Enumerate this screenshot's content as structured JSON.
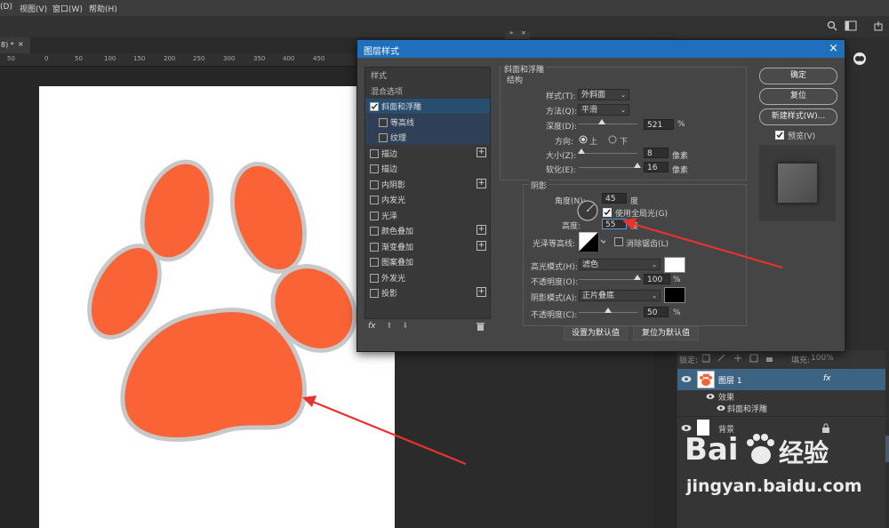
{
  "menu": {
    "items": [
      "(D)",
      "视图(V)",
      "窗口(W)",
      "帮助(H)"
    ]
  },
  "document": {
    "tab_label": "8) *",
    "close": "×"
  },
  "ruler": {
    "ticks": [
      "50",
      "0",
      "50",
      "100",
      "150",
      "200",
      "250",
      "300",
      "350",
      "400",
      "450"
    ]
  },
  "colors": {
    "paw": "#f96336",
    "paw_outline": "#c8c8c8",
    "annotation": "#e8322e",
    "accent": "#1f6fbd",
    "canvas": "#ffffff"
  },
  "dialog": {
    "title": "图层样式",
    "close": "×",
    "styles_list": [
      {
        "label": "样式",
        "checkbox": false,
        "checked": false,
        "plus": false,
        "state": "header"
      },
      {
        "label": "混合选项",
        "checkbox": false,
        "checked": false,
        "plus": false,
        "state": "header"
      },
      {
        "label": "斜面和浮雕",
        "checkbox": true,
        "checked": true,
        "plus": false,
        "state": "selected"
      },
      {
        "label": "等高线",
        "checkbox": true,
        "checked": false,
        "plus": false,
        "state": "sub"
      },
      {
        "label": "纹理",
        "checkbox": true,
        "checked": false,
        "plus": false,
        "state": "sub"
      },
      {
        "label": "描边",
        "checkbox": true,
        "checked": false,
        "plus": true,
        "state": ""
      },
      {
        "label": "描边",
        "checkbox": true,
        "checked": false,
        "plus": false,
        "state": ""
      },
      {
        "label": "内阴影",
        "checkbox": true,
        "checked": false,
        "plus": true,
        "state": ""
      },
      {
        "label": "内发光",
        "checkbox": true,
        "checked": false,
        "plus": false,
        "state": ""
      },
      {
        "label": "光泽",
        "checkbox": true,
        "checked": false,
        "plus": false,
        "state": ""
      },
      {
        "label": "颜色叠加",
        "checkbox": true,
        "checked": false,
        "plus": true,
        "state": ""
      },
      {
        "label": "渐变叠加",
        "checkbox": true,
        "checked": false,
        "plus": true,
        "state": ""
      },
      {
        "label": "图案叠加",
        "checkbox": true,
        "checked": false,
        "plus": false,
        "state": ""
      },
      {
        "label": "外发光",
        "checkbox": true,
        "checked": false,
        "plus": false,
        "state": ""
      },
      {
        "label": "投影",
        "checkbox": true,
        "checked": false,
        "plus": true,
        "state": ""
      }
    ],
    "footer_icons": [
      "fx-icon",
      "arrow-up-icon",
      "arrow-down-icon",
      "trash-icon"
    ],
    "footer_fx": "fx",
    "bevel": {
      "section_title": "斜面和浮雕",
      "structure_title": "结构",
      "style_label": "样式(T):",
      "style_value": "外斜面",
      "technique_label": "方法(Q):",
      "technique_value": "平滑",
      "depth_label": "深度(D):",
      "depth_value": "521",
      "depth_unit": "%",
      "depth_level": 0.4,
      "direction_label": "方向:",
      "direction_up": "上",
      "direction_down": "下",
      "direction_selected": "上",
      "size_label": "大小(Z):",
      "size_value": "8",
      "size_unit": "像素",
      "size_level": 0.05,
      "soften_label": "软化(E):",
      "soften_value": "16",
      "soften_unit": "像素",
      "soften_level": 1.0
    },
    "shading": {
      "title": "阴影",
      "angle_label": "角度(N):",
      "angle_value": "45",
      "angle_unit": "度",
      "global_light_label": "使用全局光(G)",
      "global_light_checked": true,
      "altitude_label": "高度:",
      "altitude_value": "55",
      "altitude_unit": "度",
      "gloss_label": "光泽等高线:",
      "antialias_label": "消除锯齿(L)",
      "antialias_checked": false,
      "highlight_mode_label": "高光模式(H):",
      "highlight_mode_value": "滤色",
      "highlight_color": "#ffffff",
      "highlight_opacity_label": "不透明度(O):",
      "highlight_opacity_value": "100",
      "highlight_opacity_unit": "%",
      "highlight_opacity_level": 1.0,
      "shadow_mode_label": "阴影模式(A):",
      "shadow_mode_value": "正片叠底",
      "shadow_color": "#000000",
      "shadow_opacity_label": "不透明度(C):",
      "shadow_opacity_value": "50",
      "shadow_opacity_unit": "%",
      "shadow_opacity_level": 0.5
    },
    "buttons": {
      "make_default": "设置为默认值",
      "reset_default": "复位为默认值",
      "ok": "确定",
      "reset": "复位",
      "new_style": "新建样式(W)...",
      "preview_label": "预览(V)",
      "preview_checked": true
    }
  },
  "layers_panel": {
    "lock_label": "锁定:",
    "fill_label": "填充:",
    "fill_value": "100%",
    "layers": [
      {
        "name": "图层 1",
        "fx": "fx",
        "selected": true
      },
      {
        "name": "效果",
        "sub": true
      },
      {
        "name": "斜面和浮雕",
        "sub": true
      },
      {
        "name": "背景",
        "locked": true
      }
    ]
  },
  "watermark": {
    "brand": "Bai",
    "brand2": "经验",
    "url": "jingyan.baidu.com"
  }
}
